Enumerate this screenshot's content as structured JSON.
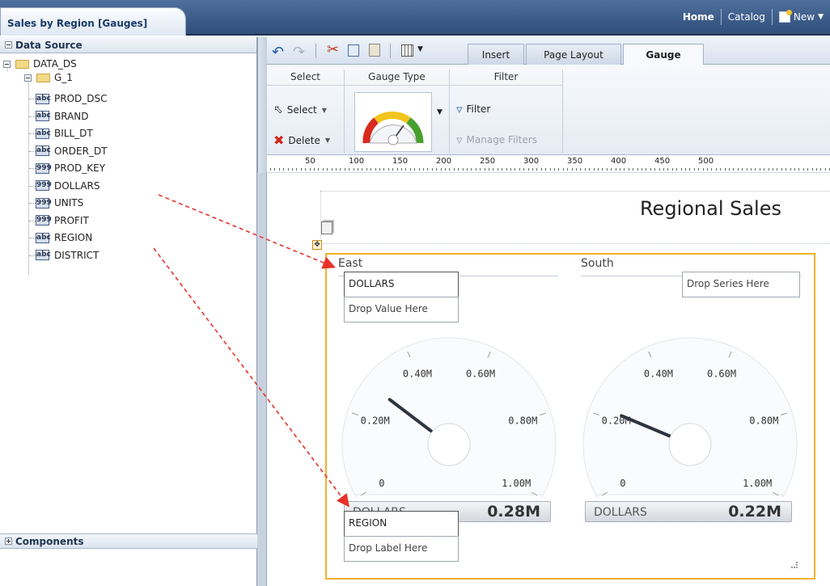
{
  "doc_tab": "Sales by Region [Gauges]",
  "topnav": {
    "home": "Home",
    "catalog": "Catalog",
    "new": "New"
  },
  "datasource": {
    "header": "Data Source",
    "root": "DATA_DS",
    "group": "G_1",
    "fields": [
      {
        "type": "abc",
        "name": "PROD_DSC"
      },
      {
        "type": "abc",
        "name": "BRAND"
      },
      {
        "type": "abc",
        "name": "BILL_DT"
      },
      {
        "type": "abc",
        "name": "ORDER_DT"
      },
      {
        "type": "999",
        "name": "PROD_KEY"
      },
      {
        "type": "999",
        "name": "DOLLARS"
      },
      {
        "type": "999",
        "name": "UNITS"
      },
      {
        "type": "999",
        "name": "PROFIT"
      },
      {
        "type": "abc",
        "name": "REGION"
      },
      {
        "type": "abc",
        "name": "DISTRICT"
      }
    ]
  },
  "components_header": "Components",
  "ribbon": {
    "tabs": [
      "Insert",
      "Page Layout",
      "Gauge"
    ],
    "active_tab": "Gauge",
    "groups": {
      "select": "Select",
      "gauge_type": "Gauge Type",
      "filter": "Filter"
    },
    "select_label": "Select",
    "delete_label": "Delete",
    "filter_label": "Filter",
    "manage_filters_label": "Manage Filters"
  },
  "ruler_labels": [
    "50",
    "100",
    "150",
    "200",
    "250",
    "300",
    "350",
    "400",
    "450",
    "500"
  ],
  "report_title": "Regional Sales",
  "gauges": [
    {
      "title": "East",
      "needle_value": 0.28,
      "value_label": "DOLLARS",
      "value": "0.28M",
      "ticks": [
        "0",
        "0.20M",
        "0.40M",
        "0.60M",
        "0.80M",
        "1.00M"
      ]
    },
    {
      "title": "South",
      "needle_value": 0.22,
      "value_label": "DOLLARS",
      "value": "0.22M",
      "ticks": [
        "0",
        "0.20M",
        "0.40M",
        "0.60M",
        "0.80M",
        "1.00M"
      ]
    }
  ],
  "drop_targets": {
    "value_field": "DOLLARS",
    "value_placeholder": "Drop Value Here",
    "series_placeholder": "Drop Series Here",
    "label_field": "REGION",
    "label_placeholder": "Drop Label Here"
  },
  "colors": {
    "accent_border": "#f2b12a",
    "arrow": "#e8322a",
    "header_bg": "#2f4e7a"
  }
}
